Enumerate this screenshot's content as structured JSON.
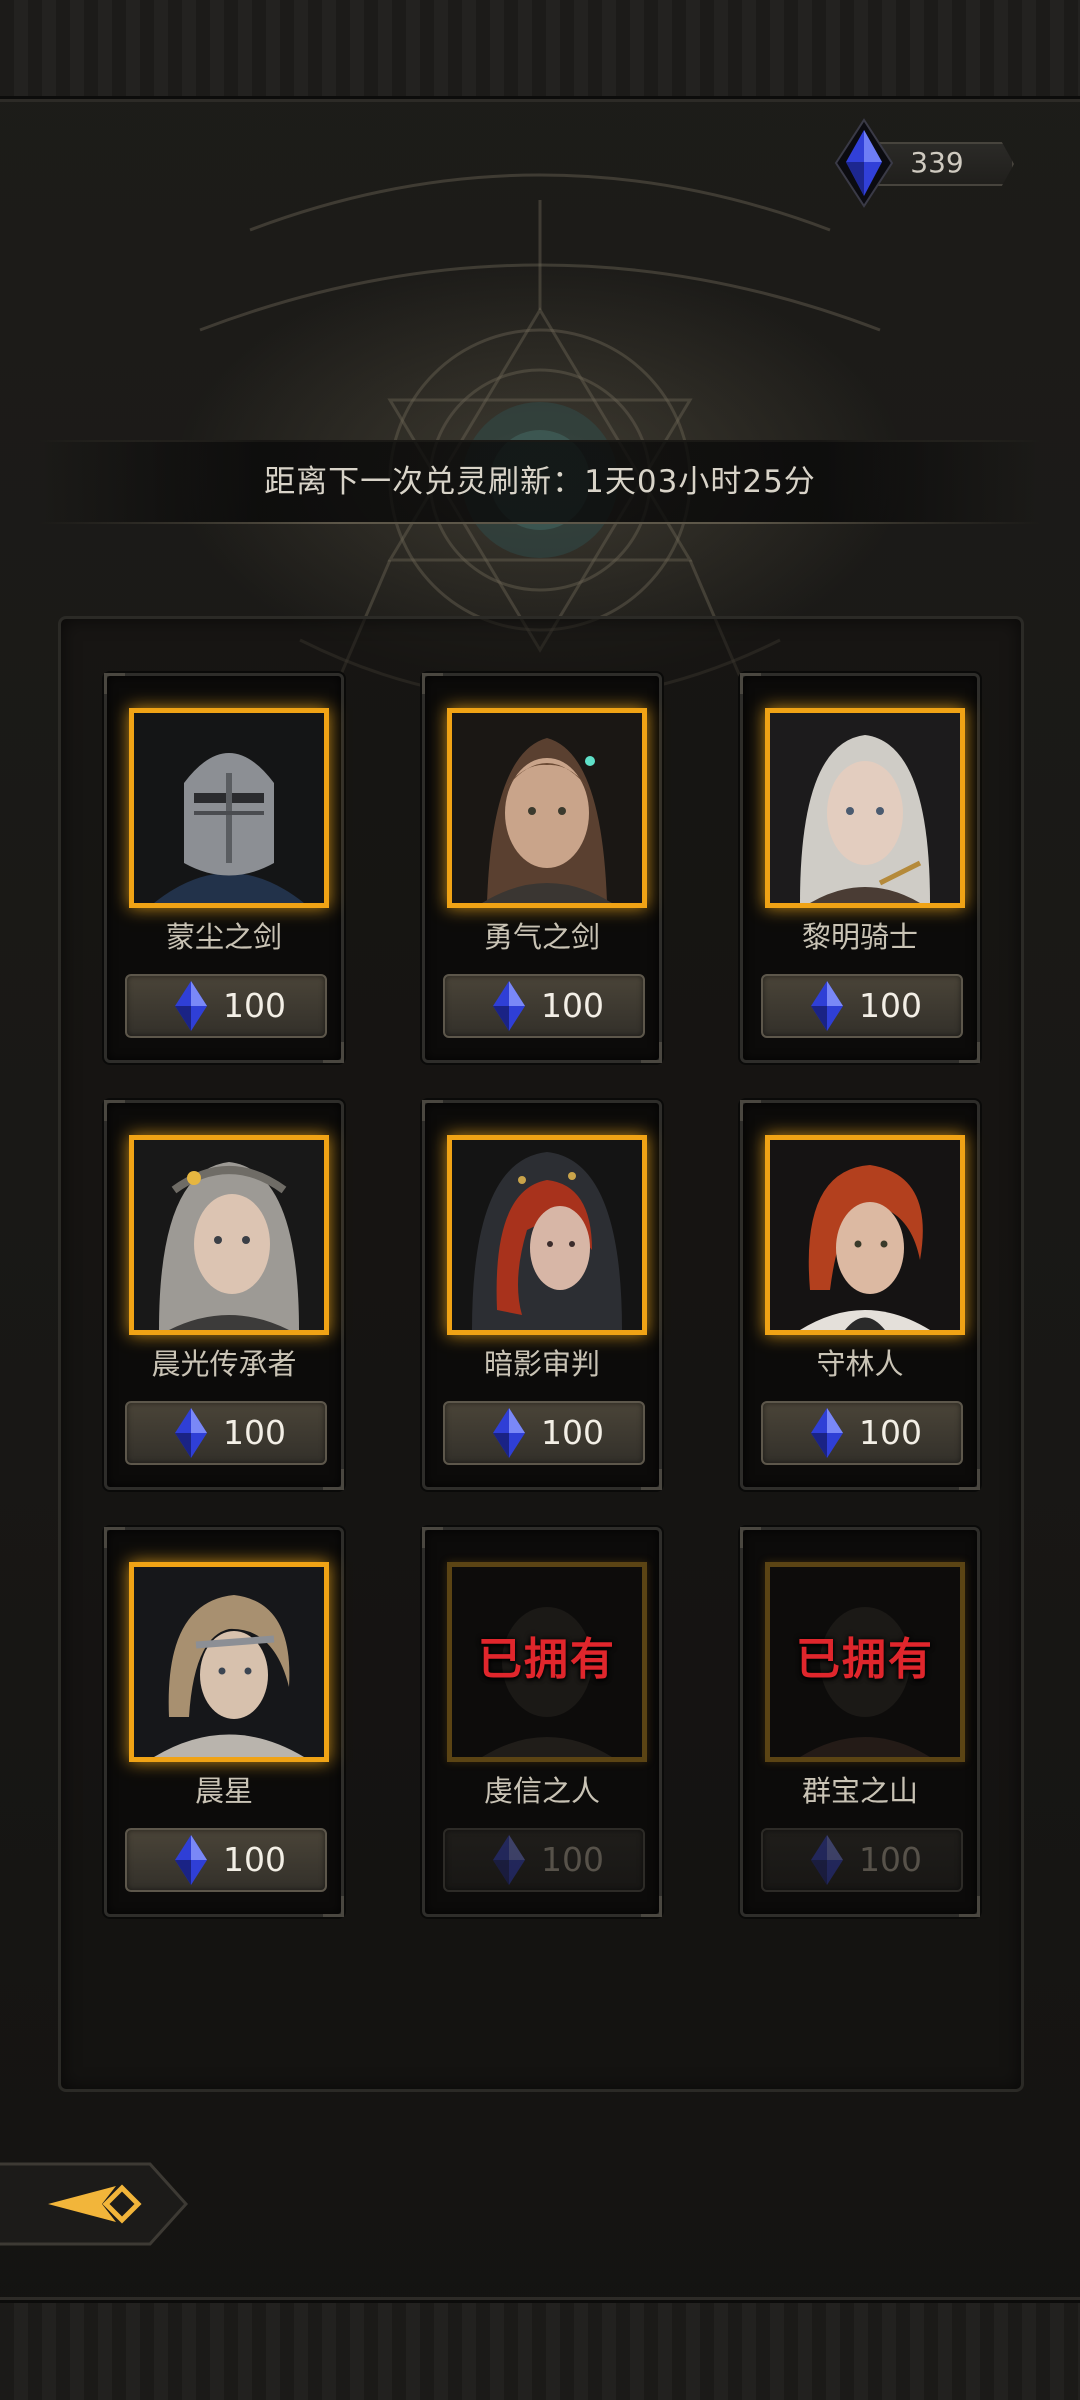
{
  "header": {
    "currency": {
      "icon": "blue-crystal-icon",
      "amount": "339"
    }
  },
  "timer": {
    "text": "距离下一次兑灵刷新：1天03小时25分"
  },
  "heroes": [
    {
      "name": "蒙尘之剑",
      "price": "100",
      "owned": false,
      "portrait": "helmeted-knight-portrait"
    },
    {
      "name": "勇气之剑",
      "price": "100",
      "owned": false,
      "portrait": "brown-haired-warrior-portrait"
    },
    {
      "name": "黎明骑士",
      "price": "100",
      "owned": false,
      "portrait": "white-haired-knight-portrait"
    },
    {
      "name": "晨光传承者",
      "price": "100",
      "owned": false,
      "portrait": "silver-haired-heir-portrait"
    },
    {
      "name": "暗影审判",
      "price": "100",
      "owned": false,
      "portrait": "hooded-red-haired-portrait"
    },
    {
      "name": "守林人",
      "price": "100",
      "owned": false,
      "portrait": "red-haired-ranger-portrait"
    },
    {
      "name": "晨星",
      "price": "100",
      "owned": false,
      "portrait": "blonde-fur-collar-portrait"
    },
    {
      "name": "虔信之人",
      "price": "100",
      "owned": true,
      "owned_label": "已拥有",
      "portrait": "dark-portrait"
    },
    {
      "name": "群宝之山",
      "price": "100",
      "owned": true,
      "owned_label": "已拥有",
      "portrait": "dark-portrait"
    }
  ],
  "colors": {
    "frame_gold": "#f0a315",
    "owned_red": "#e0262c",
    "crystal_blue": "#3c4fe6"
  },
  "footer": {
    "back_icon": "back-arrow-icon"
  }
}
